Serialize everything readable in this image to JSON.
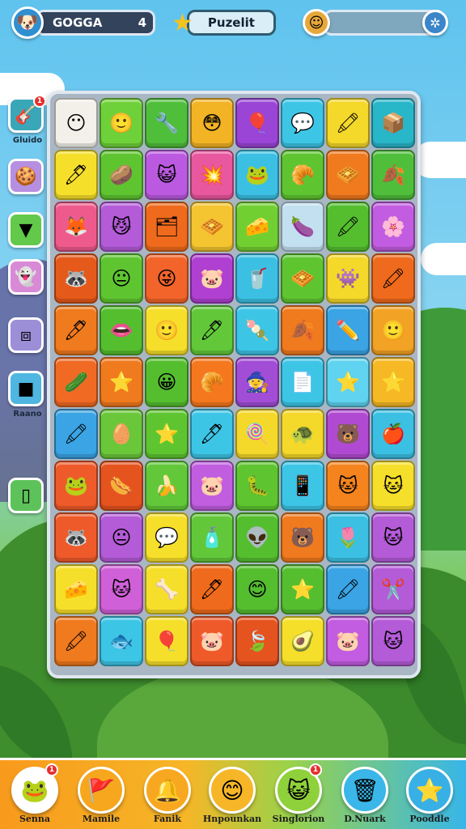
{
  "hud": {
    "profile_name": "GOGGA",
    "profile_icon": "dog-avatar-icon",
    "level_value": "4",
    "title": "Puzelit",
    "title_icon": "star-icon",
    "progress_icon": "smiley-coin-icon",
    "progress_fraction": 0.0,
    "settings_icon": "gear-icon"
  },
  "side": {
    "items": [
      {
        "name": "guitar",
        "icon": "guitar-icon",
        "glyph": "🎸",
        "label": "Gluido",
        "badge": "1",
        "color": "#3aa7b8"
      },
      {
        "name": "cookie",
        "icon": "cookie-icon",
        "glyph": "🍪",
        "label": "",
        "badge": "",
        "color": "#b78fe0"
      },
      {
        "name": "triangle",
        "icon": "triangle-icon",
        "glyph": "▼",
        "label": "",
        "badge": "",
        "color": "#62c94a"
      },
      {
        "name": "ghost",
        "icon": "ghost-face-icon",
        "glyph": "👻",
        "label": "",
        "badge": "",
        "color": "#d88ad7"
      },
      {
        "name": "frame",
        "icon": "frame-icon",
        "glyph": "⧈",
        "label": "",
        "badge": "",
        "color": "#9d8ed8"
      },
      {
        "name": "square",
        "icon": "square-icon",
        "glyph": "■",
        "label": "Raano",
        "badge": "",
        "color": "#4eb6e0"
      },
      {
        "name": "phone",
        "icon": "phone-icon",
        "glyph": "▯",
        "label": "",
        "badge": "",
        "color": "#5ec25b"
      }
    ]
  },
  "board": {
    "rows": [
      [
        [
          "#f3f0ea",
          "😶"
        ],
        [
          "#6fd13a",
          "🙂"
        ],
        [
          "#4fbf3b",
          "🔧"
        ],
        [
          "#f2b325",
          "😳"
        ],
        [
          "#9a45d6",
          "🎈"
        ],
        [
          "#3dc5e6",
          "💬"
        ],
        [
          "#f4d82a",
          "🖍"
        ],
        [
          "#28b6c9",
          "📦"
        ]
      ],
      [
        [
          "#f6df2a",
          "🖊"
        ],
        [
          "#5ec530",
          "🥔"
        ],
        [
          "#bb5ae0",
          "😺"
        ],
        [
          "#e8589e",
          "💥"
        ],
        [
          "#3bc0e3",
          "🐸"
        ],
        [
          "#5ec530",
          "🥐"
        ],
        [
          "#f07a1e",
          "🧇"
        ],
        [
          "#4fbf3b",
          "🍂"
        ]
      ],
      [
        [
          "#ef5a8c",
          "🦊"
        ],
        [
          "#b45bd8",
          "😼"
        ],
        [
          "#ef6a1c",
          "🗂"
        ],
        [
          "#f4c530",
          "🧇"
        ],
        [
          "#72cf32",
          "🧀"
        ],
        [
          "#c3e0f0",
          "🍆"
        ],
        [
          "#55be2f",
          "🖍"
        ],
        [
          "#c25ce0",
          "🌸"
        ]
      ],
      [
        [
          "#e55a1a",
          "🦝"
        ],
        [
          "#5ec530",
          "😐"
        ],
        [
          "#f2642a",
          "😜"
        ],
        [
          "#b040d2",
          "🐷"
        ],
        [
          "#3bc0e3",
          "🥤"
        ],
        [
          "#5ec530",
          "🧇"
        ],
        [
          "#f4d82a",
          "👾"
        ],
        [
          "#ef6a1c",
          "🖍"
        ]
      ],
      [
        [
          "#f07a1e",
          "🖊"
        ],
        [
          "#55be2f",
          "👄"
        ],
        [
          "#f6df2a",
          "🙂"
        ],
        [
          "#62c83a",
          "🖊"
        ],
        [
          "#3dc5e6",
          "🍡"
        ],
        [
          "#f07a1e",
          "🍂"
        ],
        [
          "#3aa4e4",
          "✏️"
        ],
        [
          "#f2a224",
          "🙂"
        ]
      ],
      [
        [
          "#f06a24",
          "🥒"
        ],
        [
          "#f07a1e",
          "⭐"
        ],
        [
          "#55be2f",
          "😀"
        ],
        [
          "#f5781e",
          "🥐"
        ],
        [
          "#a24dd6",
          "🧙"
        ],
        [
          "#3dc5e6",
          "📄"
        ],
        [
          "#5fd3f0",
          "⭐"
        ],
        [
          "#f6b824",
          "⭐"
        ]
      ],
      [
        [
          "#3aa4e4",
          "🖍"
        ],
        [
          "#6ac73a",
          "🥚"
        ],
        [
          "#5ec530",
          "⭐"
        ],
        [
          "#3dc5e6",
          "🖊"
        ],
        [
          "#f4d82a",
          "🍭"
        ],
        [
          "#f4d82a",
          "🐢"
        ],
        [
          "#b14ad2",
          "🐻"
        ],
        [
          "#3bc0e3",
          "🍎"
        ]
      ],
      [
        [
          "#ef5a2a",
          "🐸"
        ],
        [
          "#e5531f",
          "🌭"
        ],
        [
          "#62c83a",
          "🍌"
        ],
        [
          "#c15ee0",
          "🐷"
        ],
        [
          "#5ec530",
          "🐛"
        ],
        [
          "#3dc5e6",
          "📱"
        ],
        [
          "#f5841e",
          "🐱"
        ],
        [
          "#f6df2a",
          "🐱"
        ]
      ],
      [
        [
          "#ef5a2a",
          "🦝"
        ],
        [
          "#b45bd8",
          "😐"
        ],
        [
          "#f6df2a",
          "💬"
        ],
        [
          "#62c83a",
          "🧴"
        ],
        [
          "#55be2f",
          "👽"
        ],
        [
          "#f07a1e",
          "🐻"
        ],
        [
          "#3bc0e3",
          "🌷"
        ],
        [
          "#b45bd8",
          "🐱"
        ]
      ],
      [
        [
          "#f6df2a",
          "🧀"
        ],
        [
          "#d060d8",
          "🐱"
        ],
        [
          "#f6df2a",
          "🦴"
        ],
        [
          "#ef6a1c",
          "🖊"
        ],
        [
          "#55be2f",
          "😊"
        ],
        [
          "#55be2f",
          "⭐"
        ],
        [
          "#3aa4e4",
          "🖍"
        ],
        [
          "#b45bd8",
          "✂️"
        ]
      ],
      [
        [
          "#f07a1e",
          "🖍"
        ],
        [
          "#3dc5e6",
          "🐟"
        ],
        [
          "#f6df2a",
          "🎈"
        ],
        [
          "#ef5a2a",
          "🐷"
        ],
        [
          "#e5531f",
          "🍃"
        ],
        [
          "#f6df2a",
          "🥑"
        ],
        [
          "#c25ce0",
          "🐷"
        ],
        [
          "#b45bd8",
          "🐱"
        ]
      ]
    ]
  },
  "bottom": {
    "items": [
      {
        "name": "senna",
        "icon": "frog-icon",
        "glyph": "🐸",
        "label": "Senna",
        "badge": "1",
        "color": "#ffffff"
      },
      {
        "name": "mamile",
        "icon": "flag-icon",
        "glyph": "🚩",
        "label": "Mamile",
        "badge": "",
        "color": "#f6a71e"
      },
      {
        "name": "fanik",
        "icon": "bell-icon",
        "glyph": "🔔",
        "label": "Fanik",
        "badge": "",
        "color": "#f8a820"
      },
      {
        "name": "hnpounkan",
        "icon": "smiley-icon",
        "glyph": "😊",
        "label": "Hnpounkan",
        "badge": "",
        "color": "#f6b627"
      },
      {
        "name": "singlorion",
        "icon": "face-icon",
        "glyph": "😺",
        "label": "Singlorion",
        "badge": "1",
        "color": "#8fd13a"
      },
      {
        "name": "dnuark",
        "icon": "trash-can-icon",
        "glyph": "🗑",
        "label": "D.Nuark",
        "badge": "",
        "color": "#3ab6e8"
      },
      {
        "name": "pooddle",
        "icon": "star-icon",
        "glyph": "⭐",
        "label": "Pooddle",
        "badge": "",
        "color": "#38b0e6"
      }
    ]
  }
}
